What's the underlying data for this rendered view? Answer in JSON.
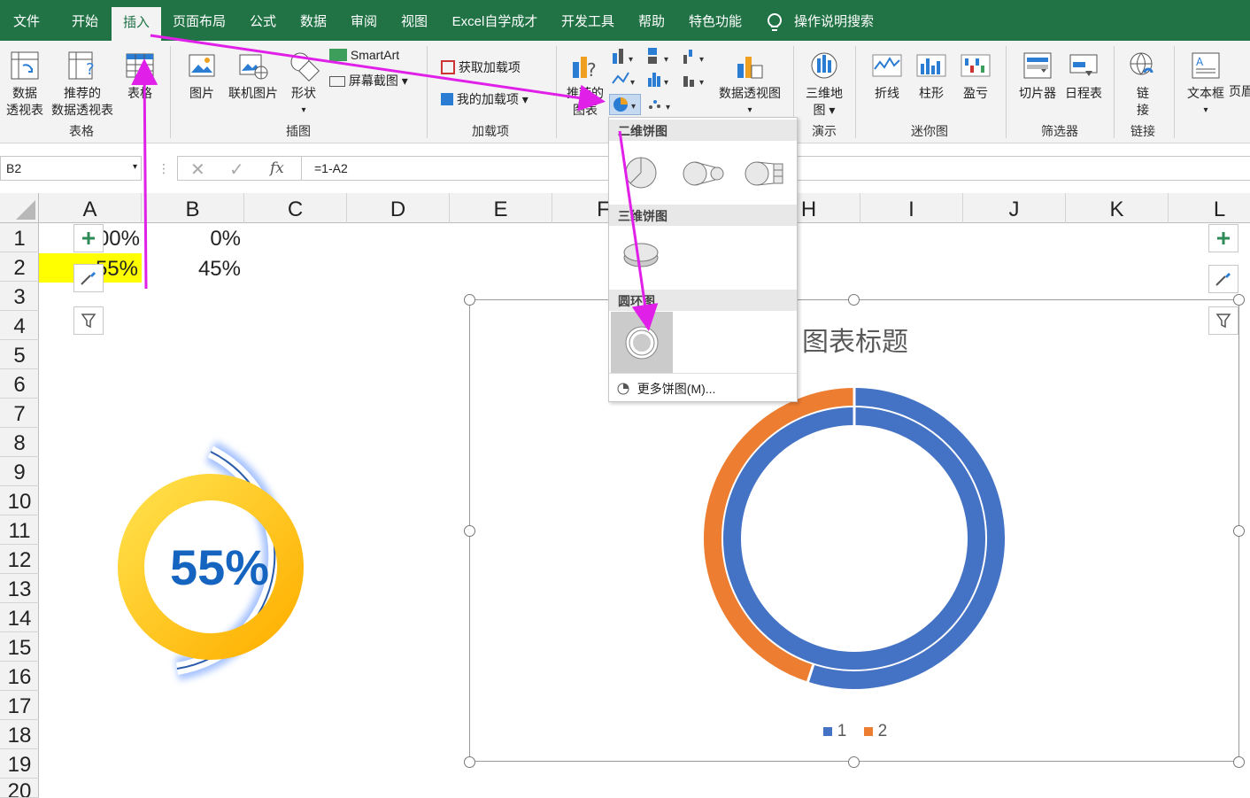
{
  "tabs": [
    {
      "label": "文件"
    },
    {
      "label": "开始"
    },
    {
      "label": "插入"
    },
    {
      "label": "页面布局"
    },
    {
      "label": "公式"
    },
    {
      "label": "数据"
    },
    {
      "label": "审阅"
    },
    {
      "label": "视图"
    },
    {
      "label": "Excel自学成才"
    },
    {
      "label": "开发工具"
    },
    {
      "label": "帮助"
    },
    {
      "label": "特色功能"
    },
    {
      "label": "操作说明搜索"
    }
  ],
  "ribbon": {
    "pivot_line1": "数据",
    "pivot_line2": "透视表",
    "rec_pivot_line1": "推荐的",
    "rec_pivot_line2": "数据透视表",
    "table": "表格",
    "group_tables": "表格",
    "pictures": "图片",
    "online_pictures": "联机图片",
    "shapes": "形状",
    "smartart": "SmartArt",
    "screenshot": "屏幕截图",
    "group_illustrations": "插图",
    "get_addins": "获取加载项",
    "my_addins": "我的加载项",
    "group_addins": "加载项",
    "rec_charts_line1": "推荐的",
    "rec_charts_line2": "图表",
    "pivotchart": "数据透视图",
    "map3d_line1": "三维地",
    "map3d_line2": "图",
    "group_tours": "演示",
    "spark_line": "折线",
    "spark_column": "柱形",
    "spark_winloss": "盈亏",
    "group_sparklines": "迷你图",
    "slicer": "切片器",
    "timeline": "日程表",
    "group_filters": "筛选器",
    "link_line1": "链",
    "link_line2": "接",
    "group_links": "链接",
    "textbox": "文本框",
    "header_partial": "页眉"
  },
  "formula_bar": {
    "name_box": "B2",
    "fx": "fx",
    "formula": "=1-A2"
  },
  "columns": [
    "A",
    "B",
    "C",
    "D",
    "E",
    "F",
    "G",
    "H",
    "I",
    "J",
    "K",
    "L"
  ],
  "rows": [
    "1",
    "2",
    "3",
    "4",
    "5",
    "6",
    "7",
    "8",
    "9",
    "10",
    "11",
    "12",
    "13",
    "14",
    "15",
    "16",
    "17",
    "18",
    "19",
    "20"
  ],
  "cells": {
    "a1": "00%",
    "b1": "0%",
    "a2": "55%",
    "b2": "45%"
  },
  "dropdown": {
    "section_2d": "二维饼图",
    "section_3d": "三维饼图",
    "section_doughnut": "圆环图",
    "more": "更多饼图(M)..."
  },
  "gauge": {
    "text": "55%"
  },
  "chart_data": {
    "type": "doughnut",
    "title": "图表标题",
    "series": [
      {
        "name": "1",
        "values": [
          1.0,
          0.0
        ]
      },
      {
        "name": "2",
        "values": [
          0.55,
          0.45
        ]
      }
    ],
    "legend": [
      "1",
      "2"
    ],
    "colors": [
      "#4472c4",
      "#ed7d31"
    ],
    "legend_position": "bottom"
  },
  "colors": {
    "excel_green": "#217346",
    "highlight": "#ffff00",
    "arrow": "#e020e8",
    "gauge_blue": "#1565c0"
  }
}
